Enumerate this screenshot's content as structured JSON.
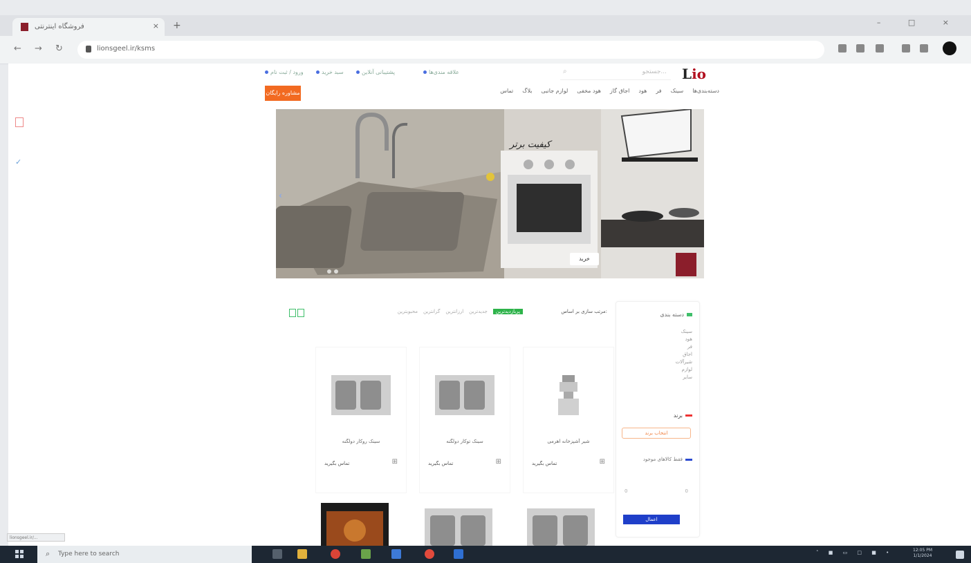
{
  "browser": {
    "tab_title": "فروشگاه اینترنتی",
    "tab_close": "×",
    "new_tab": "+",
    "url": "lionsgeel.ir/ksms",
    "window_controls": "– □ ×",
    "nav": {
      "back": "←",
      "forward": "→",
      "reload": "↻"
    }
  },
  "site": {
    "logo_main": "L",
    "logo_accent": "io",
    "search_placeholder": "جستجو...",
    "top_info": [
      "ورود / ثبت نام",
      "سبد خرید",
      "پشتیبانی آنلاین",
      "علاقه مندی‌ها"
    ],
    "cta": "مشاوره رایگان",
    "nav": [
      "دسته‌بندی‌ها",
      "سینک",
      "فر",
      "هود",
      "اجاق گاز",
      "هود مخفی",
      "لوازم جانبی",
      "بلاگ",
      "تماس"
    ]
  },
  "hero": {
    "caption": "کیفیت برتر",
    "button": "خرید",
    "prev": "‹"
  },
  "listing": {
    "sort_label": "مرتب سازی بر اساس:",
    "sort_options": [
      "پربازدیدترین",
      "جدیدترین",
      "ارزانترین",
      "گرانترین",
      "محبوبترین"
    ],
    "filters": {
      "title": "دسته بندی",
      "categories": [
        "سینک",
        "هود",
        "فر",
        "اجاق",
        "شیرآلات",
        "لوازم",
        "سایر"
      ],
      "brand_title": "برند",
      "brand_chip": "انتخاب برند",
      "availability": "فقط کالاهای موجود",
      "range_min": "0",
      "range_max": "0",
      "apply": "اعمال"
    },
    "products": [
      {
        "name": "شیر آشپزخانه اهرمی",
        "price": "تماس بگیرید"
      },
      {
        "name": "سینک توکار دولگنه",
        "price": "تماس بگیرید"
      },
      {
        "name": "سینک روکار دولگنه",
        "price": "تماس بگیرید"
      }
    ]
  },
  "os": {
    "status_tooltip": "lionsgeel.ir/...",
    "search_placeholder": "Type here to search",
    "tray": "˄ ■ ▭ □ ■ •",
    "clock_time": "12:05 PM",
    "clock_date": "1/1/2024"
  }
}
